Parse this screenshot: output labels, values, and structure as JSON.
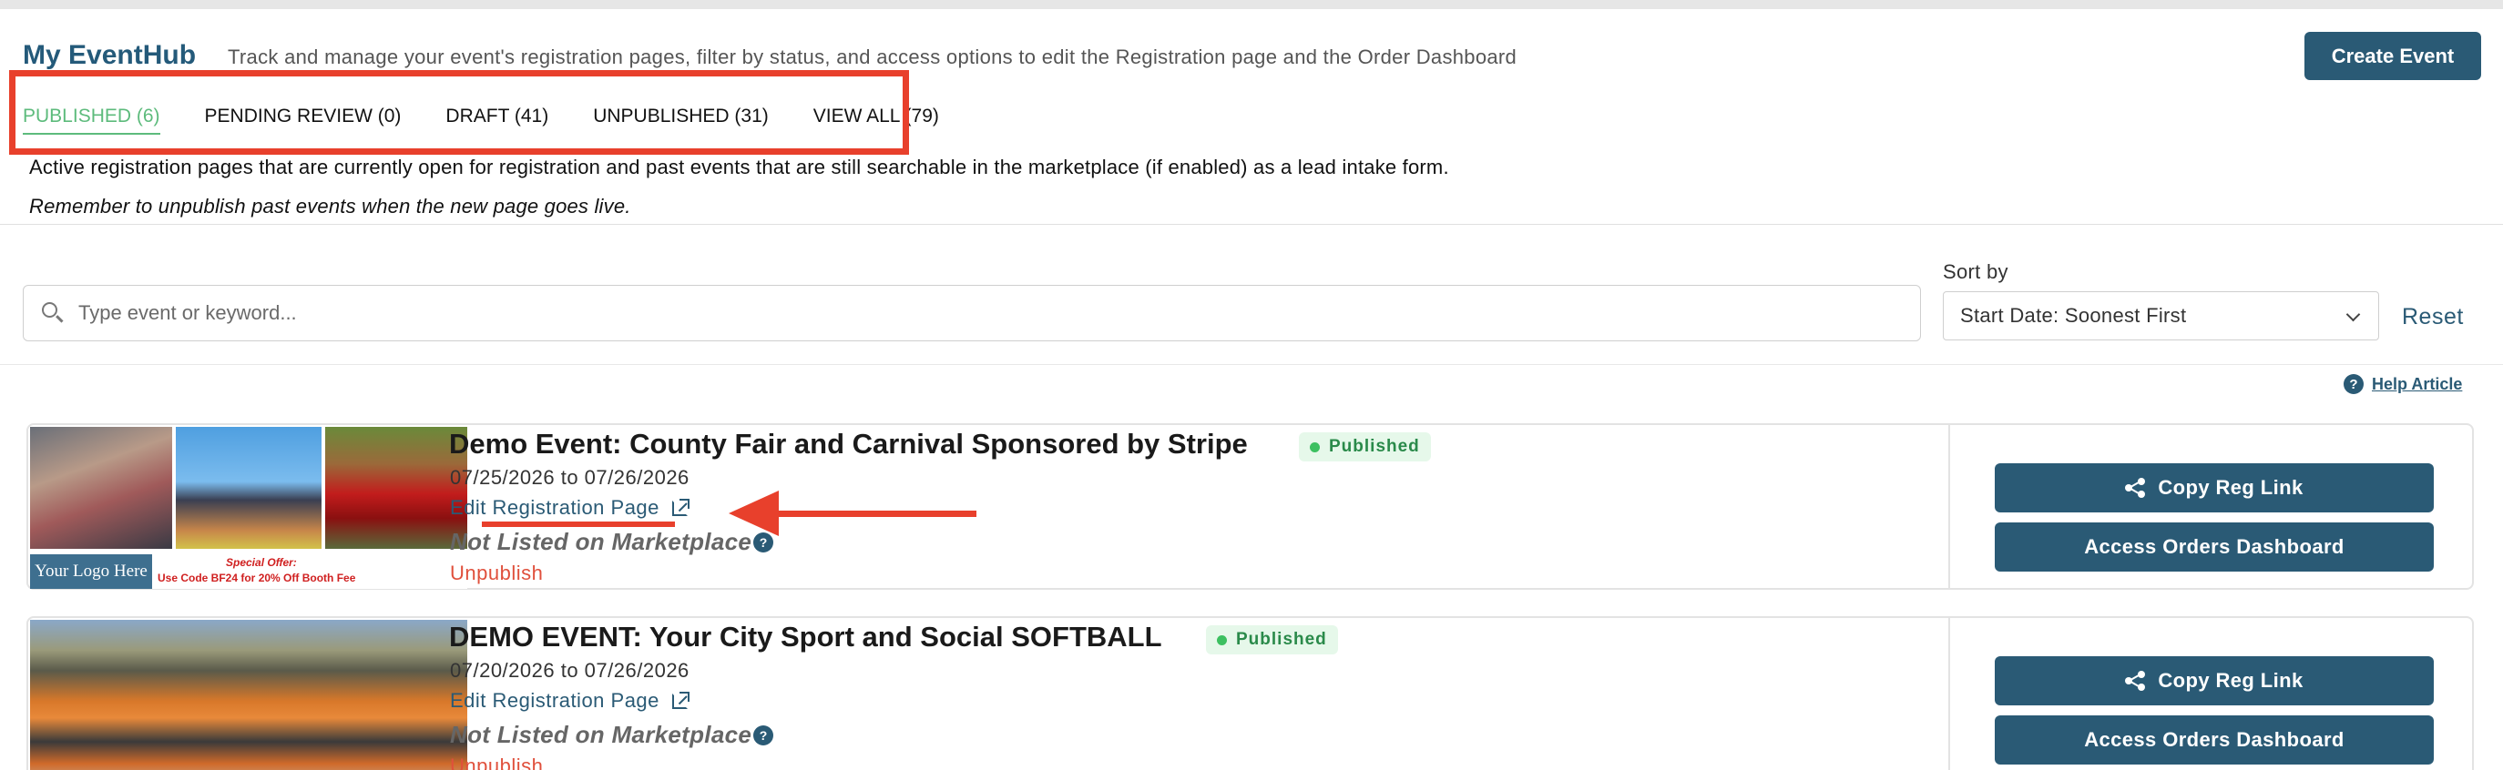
{
  "header": {
    "title": "My EventHub",
    "subtitle": "Track and manage your event's registration pages, filter by status, and access options to edit the Registration page and the Order Dashboard",
    "create_label": "Create Event"
  },
  "tabs": [
    {
      "label": "PUBLISHED (6)",
      "active": true
    },
    {
      "label": "PENDING REVIEW (0)",
      "active": false
    },
    {
      "label": "DRAFT (41)",
      "active": false
    },
    {
      "label": "UNPUBLISHED (31)",
      "active": false
    },
    {
      "label": "VIEW ALL (79)",
      "active": false
    }
  ],
  "description": {
    "line1": "Active registration pages that are currently open for registration and past events that are still searchable in the marketplace (if enabled) as a lead intake form.",
    "line2": "Remember to unpublish past events when the new page goes live."
  },
  "search": {
    "placeholder": "Type event or keyword...",
    "icon": "search-icon"
  },
  "sort": {
    "label": "Sort by",
    "selected": "Start Date: Soonest First",
    "reset_label": "Reset"
  },
  "help": {
    "label": "Help Article",
    "icon": "?"
  },
  "events": [
    {
      "title": "Demo Event: County Fair and Carnival Sponsored by Stripe",
      "status": "Published",
      "dates": "07/25/2026 to 07/26/2026",
      "edit_label": "Edit Registration Page",
      "marketplace": "Not Listed on Marketplace",
      "unpublish": "Unpublish",
      "copy_label": "Copy Reg Link",
      "orders_label": "Access Orders Dashboard",
      "logo_text": "Your Logo Here",
      "offer_line1": "Special Offer:",
      "offer_line2": "Use Code BF24 for 20% Off Booth Fee"
    },
    {
      "title": "DEMO EVENT: Your City Sport and Social SOFTBALL",
      "status": "Published",
      "dates": "07/20/2026 to 07/26/2026",
      "edit_label": "Edit Registration Page",
      "marketplace": "Not Listed on Marketplace",
      "unpublish": "Unpublish",
      "copy_label": "Copy Reg Link",
      "orders_label": "Access Orders Dashboard"
    }
  ],
  "colors": {
    "brand": "#2a5a75",
    "active_tab": "#5dbb7c",
    "annotation": "#e8402c",
    "published_bg": "#e6f8ea",
    "unpublish": "#e0503c"
  }
}
